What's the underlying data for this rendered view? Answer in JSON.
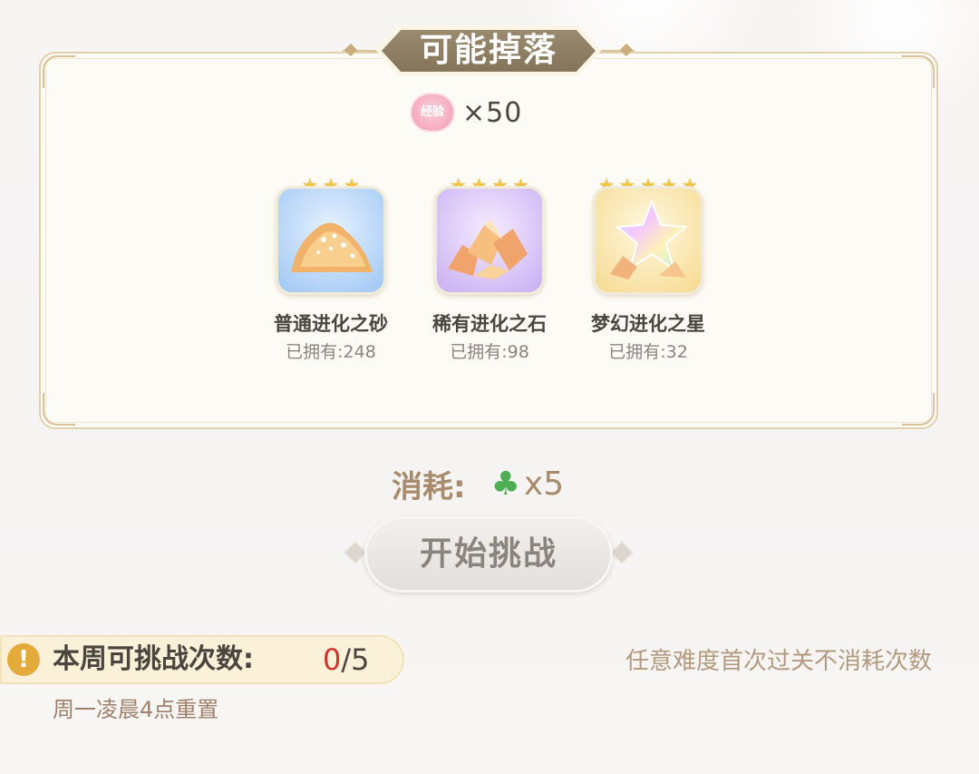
{
  "drops": {
    "title": "可能掉落",
    "exp": {
      "badge": "经验",
      "quantity": "×50",
      "icon": "exp-flower-icon"
    },
    "items": [
      {
        "name": "普通进化之砂",
        "owned": "已拥有:248",
        "stars": 3,
        "rarity_color": "#9ec6f3",
        "icon": "evolution-sand-icon"
      },
      {
        "name": "稀有进化之石",
        "owned": "已拥有:98",
        "stars": 4,
        "rarity_color": "#c8aef2",
        "icon": "evolution-stone-icon"
      },
      {
        "name": "梦幻进化之星",
        "owned": "已拥有:32",
        "stars": 5,
        "rarity_color": "#f5d98e",
        "icon": "evolution-star-icon"
      }
    ]
  },
  "cost": {
    "label": "消耗:",
    "icon": "clover-icon",
    "quantity": "x5"
  },
  "start_button": {
    "label": "开始挑战"
  },
  "weekly": {
    "label": "本周可挑战次数:",
    "used": "0",
    "total": "/5",
    "reset_note": "周一凌晨4点重置"
  },
  "note": "任意难度首次过关不消耗次数"
}
